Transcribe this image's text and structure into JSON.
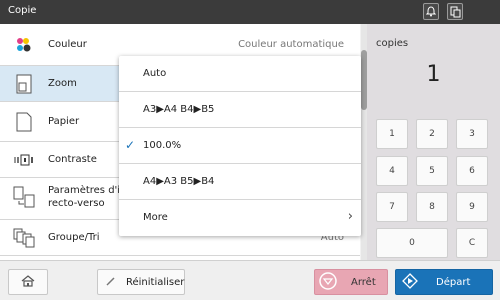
{
  "topbar": {
    "title": "Copie"
  },
  "settings": [
    {
      "label": "Couleur",
      "value": "Couleur automatique"
    },
    {
      "label": "Zoom",
      "value": ""
    },
    {
      "label": "Papier",
      "value": ""
    },
    {
      "label": "Contraste",
      "value": ""
    },
    {
      "label_line1": "Paramètres d'i",
      "label_line2": "recto-verso",
      "value": ""
    },
    {
      "label": "Groupe/Tri",
      "value": "Auto"
    }
  ],
  "zoom_dropdown": {
    "options": [
      {
        "label": "Auto",
        "selected": false
      },
      {
        "label": "A3▶A4  B4▶B5",
        "selected": false
      },
      {
        "label": "100.0%",
        "selected": true
      },
      {
        "label": "A4▶A3  B5▶B4",
        "selected": false
      },
      {
        "label": "More",
        "selected": false
      }
    ],
    "check_glyph": "✓",
    "more_glyph": "›"
  },
  "copies": {
    "label": "copies",
    "value": "1"
  },
  "keypad": [
    "1",
    "2",
    "3",
    "4",
    "5",
    "6",
    "7",
    "8",
    "9",
    "0",
    "C"
  ],
  "bottom": {
    "reset_label": "Réinitialiser",
    "stop_label": "Arrêt",
    "start_label": "Départ"
  },
  "colors": {
    "topbar": "#3b3b3b",
    "selected_row": "#d8e8f4",
    "stop_button": "#e8a6b3",
    "start_button": "#1a73b8",
    "check": "#1a73b8"
  }
}
